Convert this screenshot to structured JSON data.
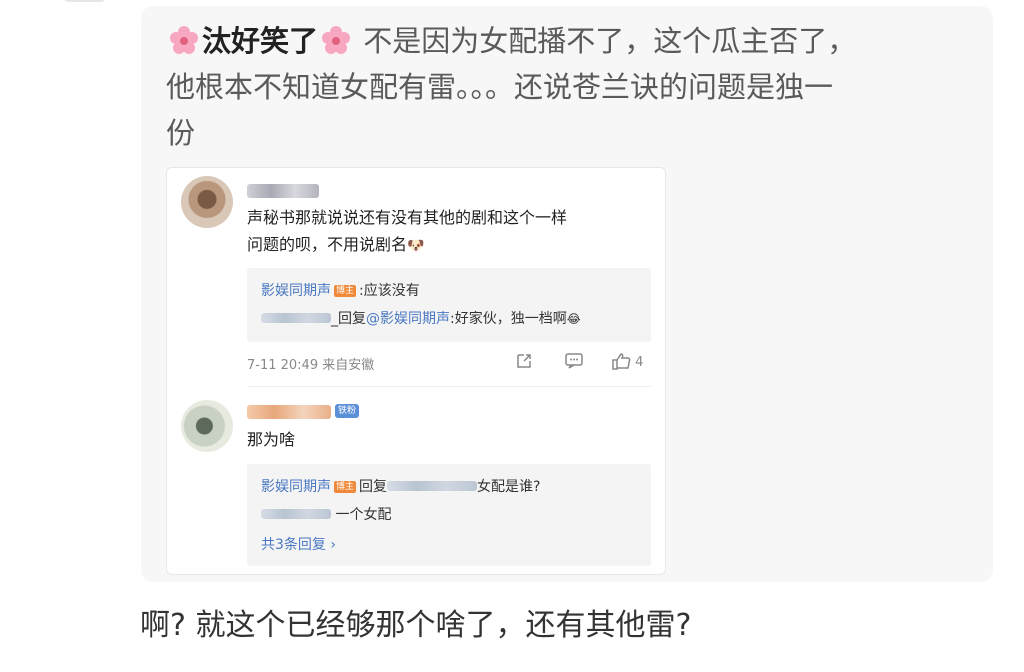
{
  "post": {
    "author": "汰好笑了",
    "text_line1": "不是因为女配播不了，这个瓜主否了，",
    "text_line2": "他根本不知道女配有雷。。。还说苍兰诀的问题是独一",
    "text_line3": "份"
  },
  "embed": {
    "comment1": {
      "text_line1": "声秘书那就说说还有没有其他的剧和这个一样",
      "text_line2": "问题的呗，不用说剧名",
      "emoji": "🐶",
      "replies": [
        {
          "user": "影娱同期声",
          "tag": "博主",
          "text": ":应该没有"
        },
        {
          "prefix": "_回复",
          "mention": "@影娱同期声",
          "text": ":好家伙，独一档啊",
          "emoji": "😂"
        }
      ],
      "time": "7-11 20:49",
      "source": "来自安徽",
      "like_count": "4"
    },
    "comment2": {
      "badge": "铁粉",
      "text": "那为啥",
      "replies": [
        {
          "user": "影娱同期声",
          "tag": "博主",
          "prefix": "回复",
          "text": "女配是谁?"
        },
        {
          "text": "一个女配"
        }
      ],
      "more_label": "共3条回复 ›"
    }
  },
  "footer": {
    "text": "啊? 就这个已经够那个啥了，还有其他雷?"
  },
  "colors": {
    "link": "#4a78c2",
    "tag": "#f08a3a",
    "card_bg": "#f7f7f7"
  },
  "icons": [
    "sakura-icon",
    "share-icon",
    "comment-icon",
    "like-icon"
  ]
}
